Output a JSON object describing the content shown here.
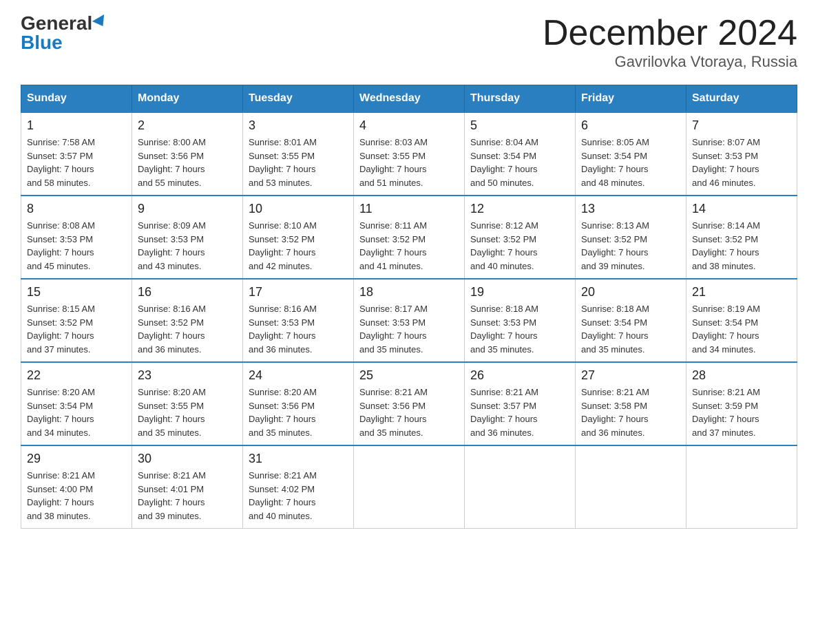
{
  "header": {
    "logo_general": "General",
    "logo_blue": "Blue",
    "month_title": "December 2024",
    "location": "Gavrilovka Vtoraya, Russia"
  },
  "days_of_week": [
    "Sunday",
    "Monday",
    "Tuesday",
    "Wednesday",
    "Thursday",
    "Friday",
    "Saturday"
  ],
  "weeks": [
    [
      {
        "day": "1",
        "info": "Sunrise: 7:58 AM\nSunset: 3:57 PM\nDaylight: 7 hours\nand 58 minutes."
      },
      {
        "day": "2",
        "info": "Sunrise: 8:00 AM\nSunset: 3:56 PM\nDaylight: 7 hours\nand 55 minutes."
      },
      {
        "day": "3",
        "info": "Sunrise: 8:01 AM\nSunset: 3:55 PM\nDaylight: 7 hours\nand 53 minutes."
      },
      {
        "day": "4",
        "info": "Sunrise: 8:03 AM\nSunset: 3:55 PM\nDaylight: 7 hours\nand 51 minutes."
      },
      {
        "day": "5",
        "info": "Sunrise: 8:04 AM\nSunset: 3:54 PM\nDaylight: 7 hours\nand 50 minutes."
      },
      {
        "day": "6",
        "info": "Sunrise: 8:05 AM\nSunset: 3:54 PM\nDaylight: 7 hours\nand 48 minutes."
      },
      {
        "day": "7",
        "info": "Sunrise: 8:07 AM\nSunset: 3:53 PM\nDaylight: 7 hours\nand 46 minutes."
      }
    ],
    [
      {
        "day": "8",
        "info": "Sunrise: 8:08 AM\nSunset: 3:53 PM\nDaylight: 7 hours\nand 45 minutes."
      },
      {
        "day": "9",
        "info": "Sunrise: 8:09 AM\nSunset: 3:53 PM\nDaylight: 7 hours\nand 43 minutes."
      },
      {
        "day": "10",
        "info": "Sunrise: 8:10 AM\nSunset: 3:52 PM\nDaylight: 7 hours\nand 42 minutes."
      },
      {
        "day": "11",
        "info": "Sunrise: 8:11 AM\nSunset: 3:52 PM\nDaylight: 7 hours\nand 41 minutes."
      },
      {
        "day": "12",
        "info": "Sunrise: 8:12 AM\nSunset: 3:52 PM\nDaylight: 7 hours\nand 40 minutes."
      },
      {
        "day": "13",
        "info": "Sunrise: 8:13 AM\nSunset: 3:52 PM\nDaylight: 7 hours\nand 39 minutes."
      },
      {
        "day": "14",
        "info": "Sunrise: 8:14 AM\nSunset: 3:52 PM\nDaylight: 7 hours\nand 38 minutes."
      }
    ],
    [
      {
        "day": "15",
        "info": "Sunrise: 8:15 AM\nSunset: 3:52 PM\nDaylight: 7 hours\nand 37 minutes."
      },
      {
        "day": "16",
        "info": "Sunrise: 8:16 AM\nSunset: 3:52 PM\nDaylight: 7 hours\nand 36 minutes."
      },
      {
        "day": "17",
        "info": "Sunrise: 8:16 AM\nSunset: 3:53 PM\nDaylight: 7 hours\nand 36 minutes."
      },
      {
        "day": "18",
        "info": "Sunrise: 8:17 AM\nSunset: 3:53 PM\nDaylight: 7 hours\nand 35 minutes."
      },
      {
        "day": "19",
        "info": "Sunrise: 8:18 AM\nSunset: 3:53 PM\nDaylight: 7 hours\nand 35 minutes."
      },
      {
        "day": "20",
        "info": "Sunrise: 8:18 AM\nSunset: 3:54 PM\nDaylight: 7 hours\nand 35 minutes."
      },
      {
        "day": "21",
        "info": "Sunrise: 8:19 AM\nSunset: 3:54 PM\nDaylight: 7 hours\nand 34 minutes."
      }
    ],
    [
      {
        "day": "22",
        "info": "Sunrise: 8:20 AM\nSunset: 3:54 PM\nDaylight: 7 hours\nand 34 minutes."
      },
      {
        "day": "23",
        "info": "Sunrise: 8:20 AM\nSunset: 3:55 PM\nDaylight: 7 hours\nand 35 minutes."
      },
      {
        "day": "24",
        "info": "Sunrise: 8:20 AM\nSunset: 3:56 PM\nDaylight: 7 hours\nand 35 minutes."
      },
      {
        "day": "25",
        "info": "Sunrise: 8:21 AM\nSunset: 3:56 PM\nDaylight: 7 hours\nand 35 minutes."
      },
      {
        "day": "26",
        "info": "Sunrise: 8:21 AM\nSunset: 3:57 PM\nDaylight: 7 hours\nand 36 minutes."
      },
      {
        "day": "27",
        "info": "Sunrise: 8:21 AM\nSunset: 3:58 PM\nDaylight: 7 hours\nand 36 minutes."
      },
      {
        "day": "28",
        "info": "Sunrise: 8:21 AM\nSunset: 3:59 PM\nDaylight: 7 hours\nand 37 minutes."
      }
    ],
    [
      {
        "day": "29",
        "info": "Sunrise: 8:21 AM\nSunset: 4:00 PM\nDaylight: 7 hours\nand 38 minutes."
      },
      {
        "day": "30",
        "info": "Sunrise: 8:21 AM\nSunset: 4:01 PM\nDaylight: 7 hours\nand 39 minutes."
      },
      {
        "day": "31",
        "info": "Sunrise: 8:21 AM\nSunset: 4:02 PM\nDaylight: 7 hours\nand 40 minutes."
      },
      {
        "day": "",
        "info": ""
      },
      {
        "day": "",
        "info": ""
      },
      {
        "day": "",
        "info": ""
      },
      {
        "day": "",
        "info": ""
      }
    ]
  ]
}
